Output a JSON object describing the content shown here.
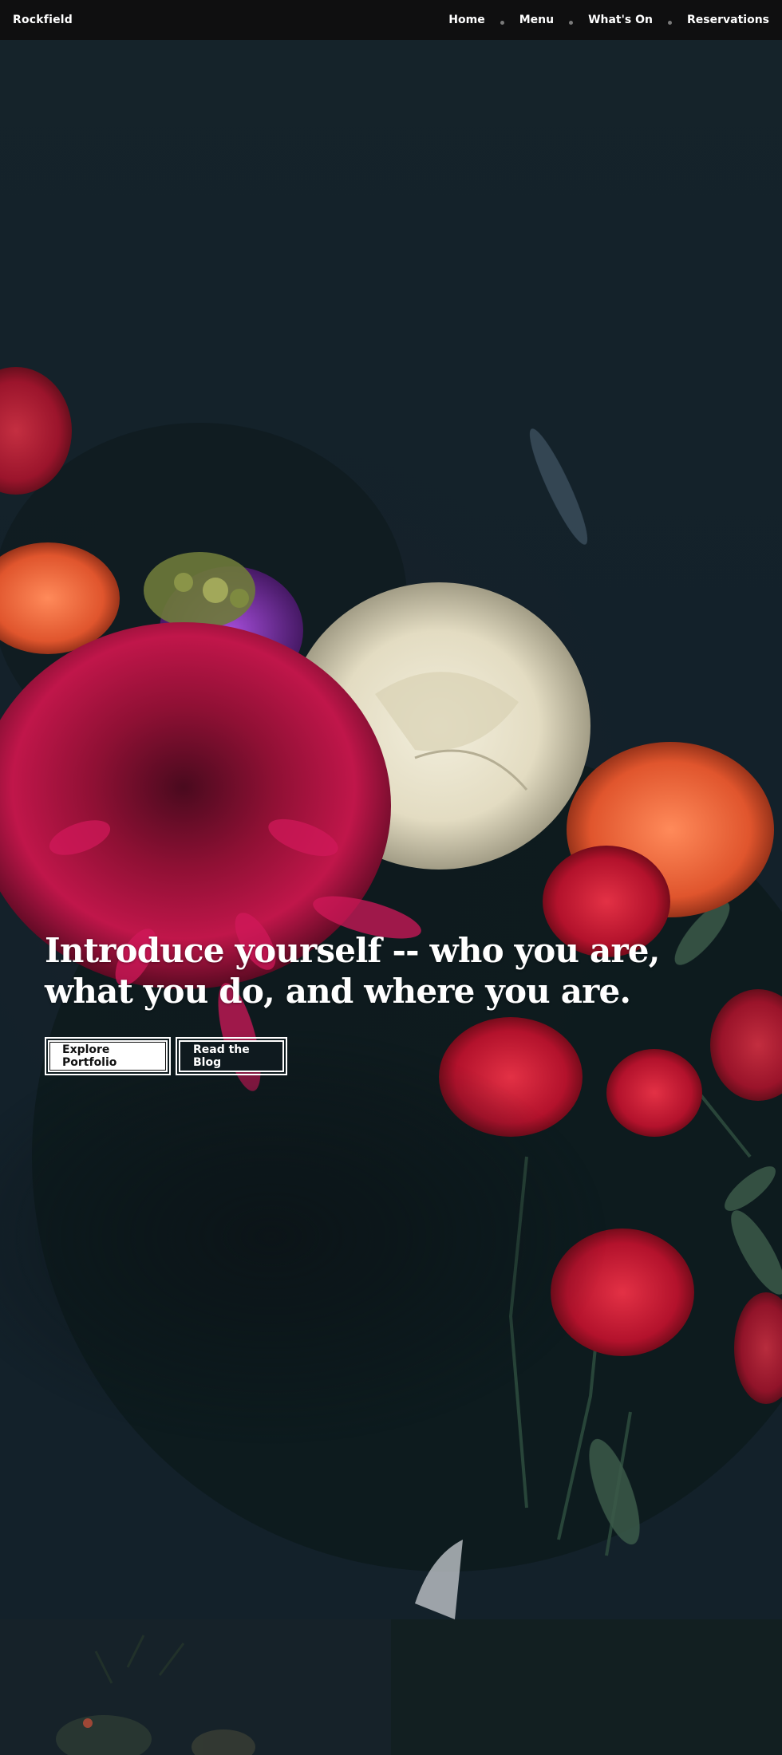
{
  "site": {
    "brand": "Rockfield"
  },
  "nav": {
    "items": [
      {
        "label": "Home"
      },
      {
        "label": "Menu"
      },
      {
        "label": "What's On"
      },
      {
        "label": "Reservations"
      }
    ]
  },
  "hero": {
    "title": "Introduce yourself -- who you are, what you do, and where you are.",
    "primary_button": "Explore Portfolio",
    "secondary_button": "Read the Blog"
  },
  "colors": {
    "topbar": "#0f0f10",
    "background": "#142128",
    "accent_red": "#c8163a",
    "accent_cream": "#e9e4cf"
  }
}
